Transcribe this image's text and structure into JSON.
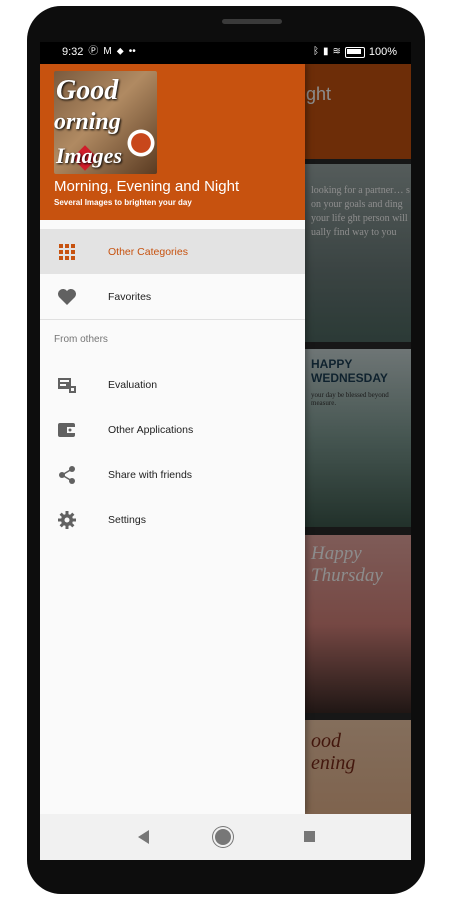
{
  "status_bar": {
    "time": "9:32",
    "left_icons": [
      "p-badge-icon",
      "gmail-icon",
      "location-icon",
      "more-icon"
    ],
    "right_icons": [
      "bluetooth-icon",
      "signal-icon",
      "wifi-icon",
      "battery-icon"
    ],
    "battery": "100%"
  },
  "background_app": {
    "toolbar_title": "light",
    "card1_text": "looking for a partner… s on your goals and ding your life ght person will ually find way to you",
    "card2_text": "HAPPY WEDNESDAY",
    "card2_sub": "your day be blessed beyond measure.",
    "card3_text": "Happy Thursday",
    "card4_text": "ood ening"
  },
  "drawer": {
    "header_image_text": [
      "Good",
      "orning",
      "Images"
    ],
    "title": "Morning, Evening and Night",
    "subtitle": "Several Images to brighten your day",
    "items": [
      {
        "label": "Other Categories",
        "icon": "grid-icon",
        "active": true
      },
      {
        "label": "Favorites",
        "icon": "heart-icon",
        "active": false
      }
    ],
    "section_label": "From others",
    "other_items": [
      {
        "label": "Evaluation",
        "icon": "rate-review-icon"
      },
      {
        "label": "Other Applications",
        "icon": "apps-wallet-icon"
      },
      {
        "label": "Share with friends",
        "icon": "share-icon"
      },
      {
        "label": "Settings",
        "icon": "gear-icon"
      }
    ]
  },
  "colors": {
    "accent": "#c7520f",
    "active_bg": "#e3e3e3"
  }
}
